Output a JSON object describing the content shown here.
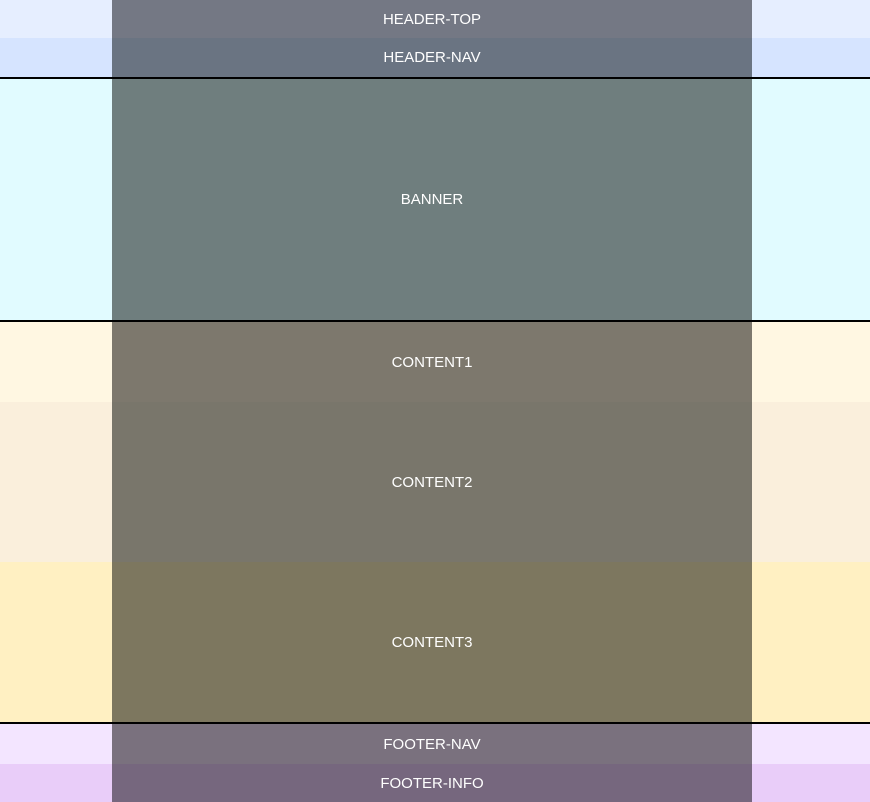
{
  "sections": {
    "header_top": "HEADER-TOP",
    "header_nav": "HEADER-NAV",
    "banner": "BANNER",
    "content1": "CONTENT1",
    "content2": "CONTENT2",
    "content3": "CONTENT3",
    "footer_nav": "FOOTER-NAV",
    "footer_info": "FOOTER-INFO"
  },
  "colors": {
    "header_top_bg": "#e6eeff",
    "header_nav_bg": "#d6e4ff",
    "banner_bg": "#e1fbff",
    "content1_bg": "#fff7e2",
    "content2_bg": "#faefdc",
    "content3_bg": "#fff0c2",
    "footer_nav_bg": "#f3e5ff",
    "footer_info_bg": "#e9cdf9",
    "overlay": "#6f7380",
    "label_text": "#ffffff",
    "separator": "#000000"
  }
}
